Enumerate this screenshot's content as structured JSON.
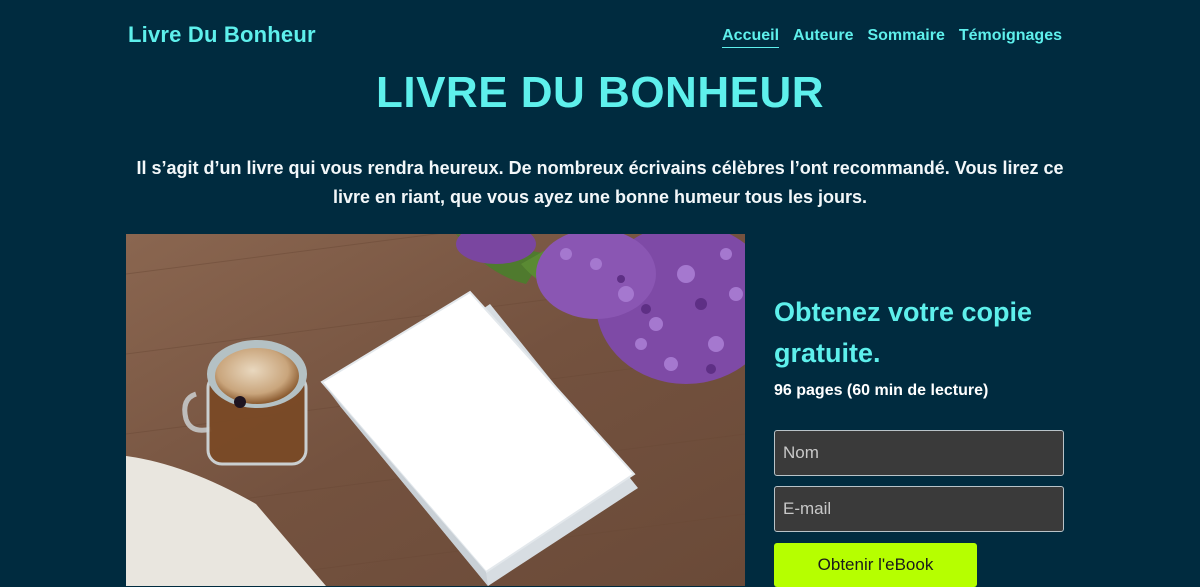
{
  "header": {
    "logo": "Livre Du Bonheur",
    "nav": [
      "Accueil",
      "Auteure",
      "Sommaire",
      "Témoignages"
    ],
    "active_index": 0
  },
  "hero": {
    "title": "LIVRE DU BONHEUR",
    "description": "Il s’agit d’un livre qui vous rendra heureux. De nombreux écrivains célèbres l’ont recommandé. Vous lirez ce livre en riant, que vous ayez une bonne humeur tous les jours."
  },
  "signup": {
    "title": "Obtenez votre copie gratuite.",
    "subtitle": "96 pages (60 min de lecture)",
    "name_placeholder": "Nom",
    "email_placeholder": "E-mail",
    "button_label": "Obtenir l'eBook"
  },
  "colors": {
    "background": "#002b3f",
    "accent": "#5ef0ec",
    "button": "#b6ff00"
  }
}
